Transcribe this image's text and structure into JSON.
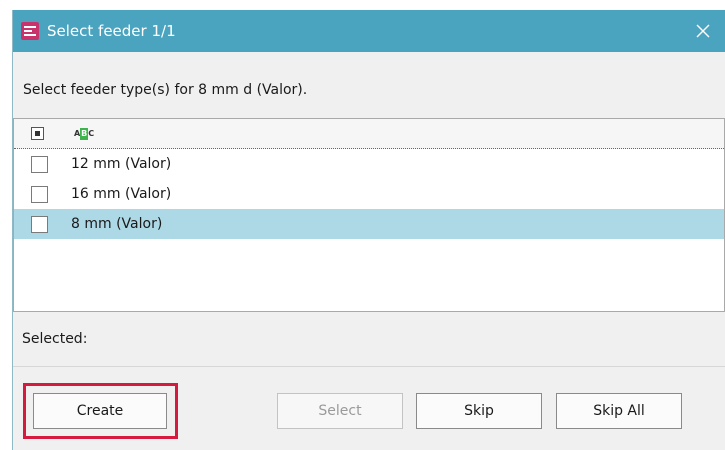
{
  "window": {
    "title": "Select feeder 1/1",
    "app_icon": "smt-app-icon",
    "close_icon": "close-icon"
  },
  "prompt": "Select feeder type(s) for 8 mm d (Valor).",
  "list": {
    "header": {
      "select_all_state": "indeterminate",
      "sort_icon": "abc-sort-icon"
    },
    "items": [
      {
        "label": "12 mm (Valor)",
        "checked": false,
        "selected": false
      },
      {
        "label": "16 mm (Valor)",
        "checked": false,
        "selected": false
      },
      {
        "label": "8 mm (Valor)",
        "checked": false,
        "selected": true
      }
    ]
  },
  "selected_label": "Selected:",
  "buttons": {
    "create": "Create",
    "select": "Select",
    "skip": "Skip",
    "skip_all": "Skip All"
  },
  "colors": {
    "titlebar": "#4aa3bf",
    "row_selected": "#add8e6",
    "highlight": "#d6193f",
    "app_icon": "#c8336b"
  }
}
